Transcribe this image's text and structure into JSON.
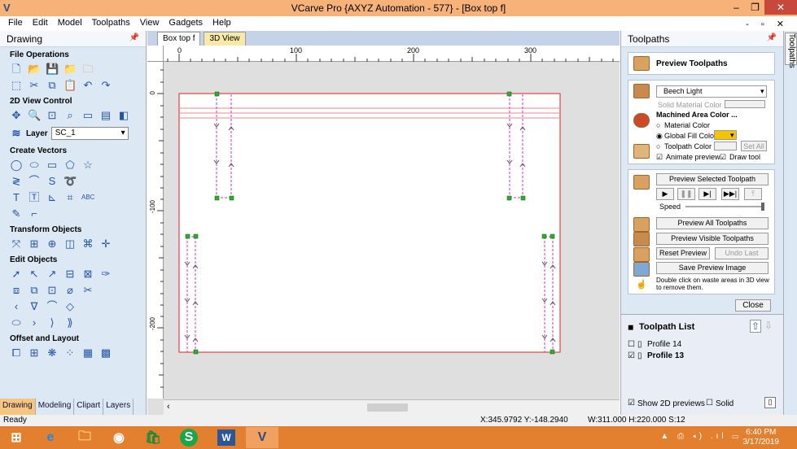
{
  "window": {
    "title": "VCarve Pro {AXYZ Automation - 577} - [Box top f]",
    "min": "–",
    "restore": "❐",
    "close": "✕"
  },
  "menu": [
    "File",
    "Edit",
    "Model",
    "Toolpaths",
    "View",
    "Gadgets",
    "Help"
  ],
  "menu_right": "- ▫ ✕",
  "left_panel": {
    "title": "Drawing",
    "sections": {
      "file_ops": "File Operations",
      "view_ctrl": "2D View Control",
      "create_vectors": "Create Vectors",
      "transform": "Transform Objects",
      "edit": "Edit Objects",
      "offset": "Offset and Layout"
    },
    "layer_label": "Layer",
    "layer_value": "SC_1",
    "tabs": [
      "Drawing",
      "Modeling",
      "Clipart",
      "Layers"
    ]
  },
  "doc": {
    "tabs": [
      "Box top f",
      "3D View"
    ],
    "ruler_top": [
      "0",
      "100",
      "200",
      "300"
    ],
    "ruler_left": [
      "0",
      "-100",
      "-200"
    ]
  },
  "right_panel": {
    "title": "Toolpaths",
    "preview_toolpaths": "Preview Toolpaths",
    "material": "Beech Light",
    "solid_material_color": "Solid Material Color",
    "machined_area_color": "Machined Area Color ...",
    "material_color": "Material Color",
    "global_fill_color": "Global Fill Color",
    "toolpath_color": "Toolpath Color",
    "set_all": "Set All",
    "animate_preview": "Animate preview",
    "draw_tool": "Draw tool",
    "preview_selected": "Preview Selected Toolpath",
    "speed": "Speed",
    "preview_all": "Preview All Toolpaths",
    "preview_visible": "Preview Visible Toolpaths",
    "reset_preview": "Reset Preview",
    "undo_last": "Undo Last",
    "save_preview_image": "Save Preview Image",
    "hint": "Double click on waste areas in 3D view to remove them.",
    "close": "Close",
    "toolpath_list_title": "Toolpath List",
    "toolpaths": [
      {
        "name": "Profile 14",
        "checked": false
      },
      {
        "name": "Profile 13",
        "checked": true
      }
    ],
    "show_2d_previews": "Show 2D previews",
    "solid": "Solid",
    "side_tab": "Toolpaths",
    "fill_color": "#f5c400"
  },
  "status": {
    "ready": "Ready",
    "coords": "X:345.9792 Y:-148.2940",
    "dims": "W:311.000  H:220.000  S:12"
  },
  "taskbar": {
    "time": "6:40 PM",
    "date": "3/17/2019",
    "tray": "▲ ⎙ ◂) .ıl ▭"
  }
}
